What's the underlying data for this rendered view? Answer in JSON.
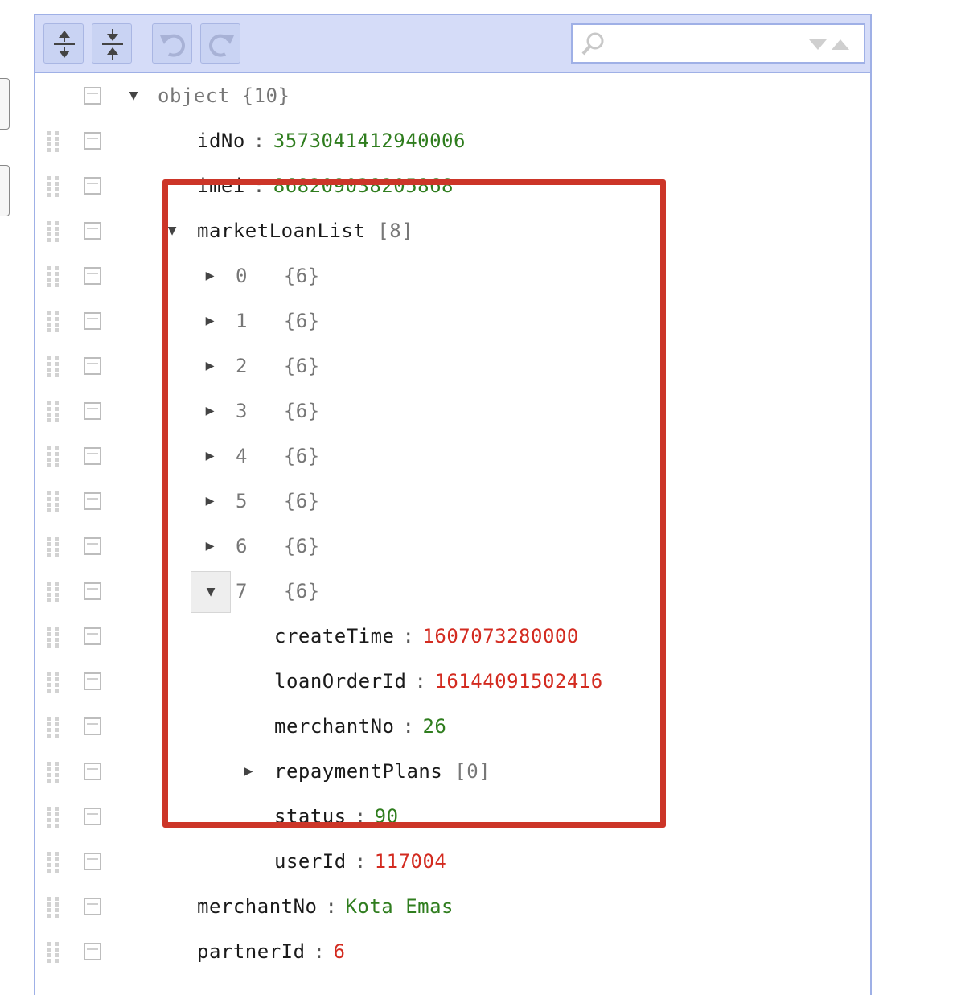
{
  "search": {
    "value": ""
  },
  "tree": [
    {
      "key": "object",
      "count": "{10}",
      "expanded": true,
      "level": 0,
      "root": true
    },
    {
      "key": "idNo",
      "value": "3573041412940006",
      "vtype": "string",
      "level": 1
    },
    {
      "key": "imei",
      "value": "868209038205868",
      "vtype": "string",
      "level": 1
    },
    {
      "key": "marketLoanList",
      "count": "[8]",
      "expanded": true,
      "level": 1
    },
    {
      "index": "0",
      "count": "{6}",
      "expanded": false,
      "level": 2
    },
    {
      "index": "1",
      "count": "{6}",
      "expanded": false,
      "level": 2
    },
    {
      "index": "2",
      "count": "{6}",
      "expanded": false,
      "level": 2
    },
    {
      "index": "3",
      "count": "{6}",
      "expanded": false,
      "level": 2
    },
    {
      "index": "4",
      "count": "{6}",
      "expanded": false,
      "level": 2
    },
    {
      "index": "5",
      "count": "{6}",
      "expanded": false,
      "level": 2
    },
    {
      "index": "6",
      "count": "{6}",
      "expanded": false,
      "level": 2
    },
    {
      "index": "7",
      "count": "{6}",
      "expanded": true,
      "selected": true,
      "level": 2
    },
    {
      "key": "createTime",
      "value": "1607073280000",
      "vtype": "number",
      "level": 3
    },
    {
      "key": "loanOrderId",
      "value": "16144091502416",
      "vtype": "number",
      "level": 3
    },
    {
      "key": "merchantNo",
      "value": "26",
      "vtype": "string",
      "level": 3
    },
    {
      "key": "repaymentPlans",
      "count": "[0]",
      "expanded": false,
      "level": 3
    },
    {
      "key": "status",
      "value": "90",
      "vtype": "string",
      "level": 3
    },
    {
      "key": "userId",
      "value": "117004",
      "vtype": "number",
      "level": 3
    },
    {
      "key": "merchantNo",
      "value": "Kota Emas",
      "vtype": "string",
      "level": 1
    },
    {
      "key": "partnerId",
      "value": "6",
      "vtype": "number",
      "level": 1
    }
  ]
}
